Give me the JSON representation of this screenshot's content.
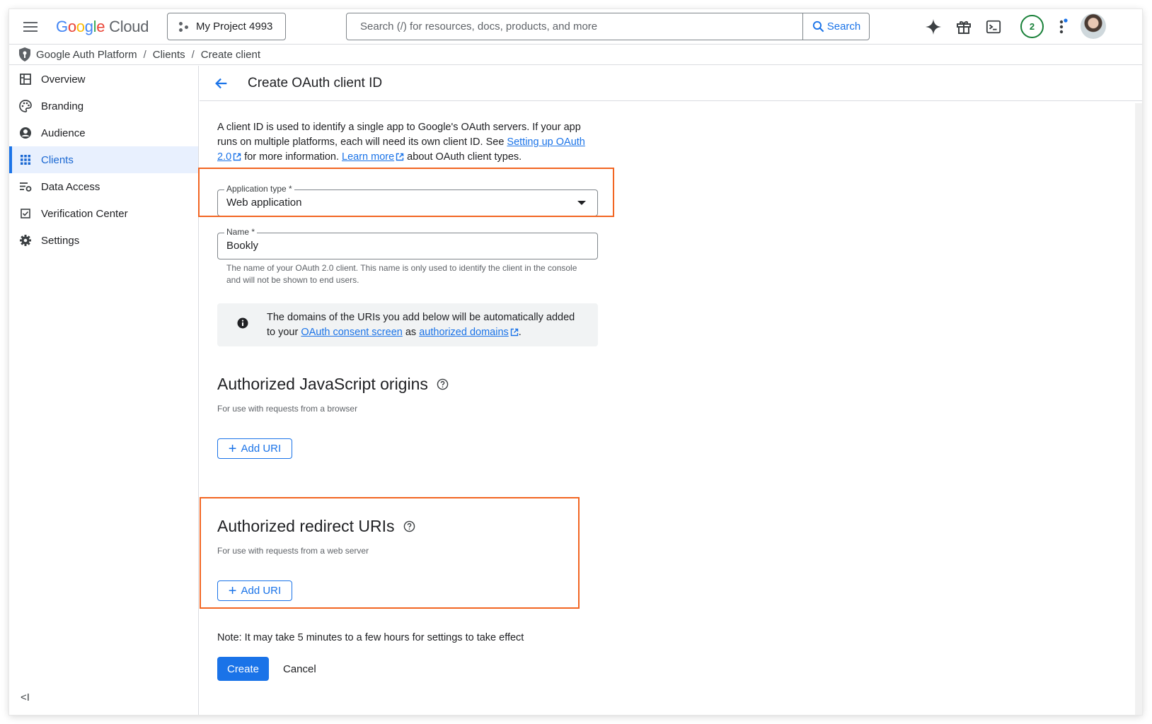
{
  "header": {
    "logo": {
      "g1": "G",
      "g2": "o",
      "g3": "o",
      "g4": "g",
      "g5": "l",
      "g6": "e",
      "cloud": "Cloud"
    },
    "project": "My Project 4993",
    "search_placeholder": "Search (/) for resources, docs, products, and more",
    "search_button": "Search",
    "notification_count": "2",
    "icons": [
      "menu-icon",
      "project-icon",
      "search-icon",
      "gemini-sparkle-icon",
      "gift-icon",
      "cloud-shell-icon",
      "more-vert-icon",
      "avatar"
    ]
  },
  "breadcrumb": [
    "Google Auth Platform",
    "Clients",
    "Create client"
  ],
  "sidebar": {
    "items": [
      {
        "label": "Overview",
        "icon": "dashboard-icon"
      },
      {
        "label": "Branding",
        "icon": "palette-icon"
      },
      {
        "label": "Audience",
        "icon": "person-icon"
      },
      {
        "label": "Clients",
        "icon": "grid-icon",
        "active": true
      },
      {
        "label": "Data Access",
        "icon": "data-access-icon"
      },
      {
        "label": "Verification Center",
        "icon": "checkbox-icon"
      },
      {
        "label": "Settings",
        "icon": "gear-icon"
      }
    ],
    "collapse_label": "<I"
  },
  "page": {
    "title": "Create OAuth client ID",
    "intro": {
      "p1": "A client ID is used to identify a single app to Google's OAuth servers. If your app runs on multiple platforms, each will need its own client ID. See ",
      "link1": "Setting up OAuth 2.0",
      "p2": " for more information. ",
      "link2": "Learn more",
      "p3": " about OAuth client types."
    },
    "app_type": {
      "label": "Application type *",
      "value": "Web application"
    },
    "name": {
      "label": "Name *",
      "value": "Bookly",
      "hint": "The name of your OAuth 2.0 client. This name is only used to identify the client in the console and will not be shown to end users."
    },
    "info": {
      "p1": "The domains of the URIs you add below will be automatically added to your ",
      "link1": "OAuth consent screen",
      "p2": " as ",
      "link2": "authorized domains",
      "p3": "."
    },
    "js_origins": {
      "title": "Authorized JavaScript origins",
      "subtitle": "For use with requests from a browser",
      "button": "Add URI"
    },
    "redirect_uris": {
      "title": "Authorized redirect URIs",
      "subtitle": "For use with requests from a web server",
      "button": "Add URI"
    },
    "note": "Note: It may take 5 minutes to a few hours for settings to take effect",
    "create_button": "Create",
    "cancel_button": "Cancel"
  },
  "colors": {
    "accent": "#1a73e8",
    "highlight": "#f26522",
    "active_bg": "#e8f0fe"
  }
}
